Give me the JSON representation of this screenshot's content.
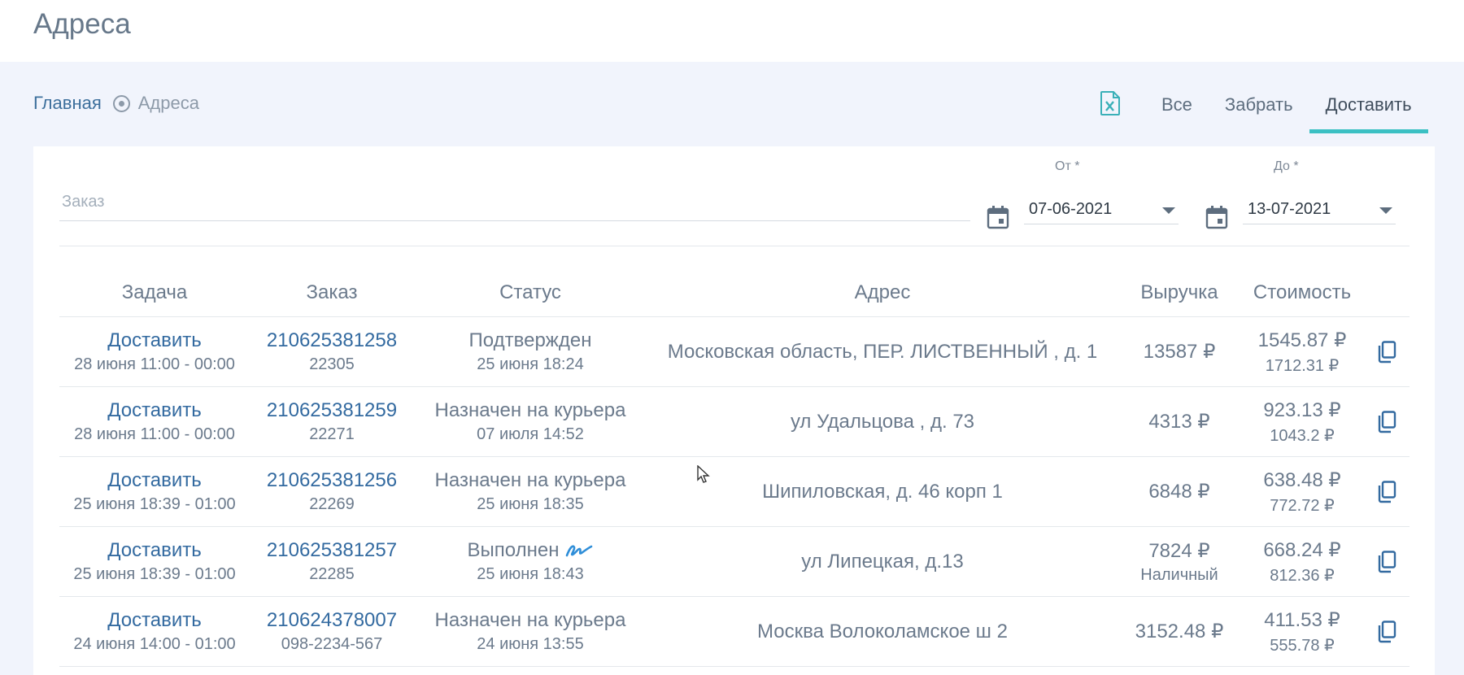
{
  "header": {
    "title": "Адреса"
  },
  "breadcrumb": {
    "home": "Главная",
    "current": "Адреса"
  },
  "toolbar": {
    "export_icon": "excel-file-icon"
  },
  "tabs": [
    {
      "label": "Все",
      "active": false
    },
    {
      "label": "Забрать",
      "active": false
    },
    {
      "label": "Доставить",
      "active": true
    }
  ],
  "filters": {
    "order_placeholder": "Заказ",
    "from": {
      "label": "От *",
      "value": "07-06-2021"
    },
    "to": {
      "label": "До *",
      "value": "13-07-2021"
    }
  },
  "table": {
    "headers": [
      "Задача",
      "Заказ",
      "Статус",
      "Адрес",
      "Выручка",
      "Стоимость"
    ],
    "rows": [
      {
        "task": "Доставить",
        "task_time": "28 июня 11:00 - 00:00",
        "order": "210625381258",
        "order_sub": "22305",
        "status": "Подтвержден",
        "status_time": "25 июня 18:24",
        "address": "Московская область, ПЕР. ЛИСТВЕННЫЙ , д. 1",
        "revenue": "13587 ₽",
        "revenue_sub": "",
        "cost": "1545.87 ₽",
        "cost_sub": "1712.31 ₽"
      },
      {
        "task": "Доставить",
        "task_time": "28 июня 11:00 - 00:00",
        "order": "210625381259",
        "order_sub": "22271",
        "status": "Назначен на курьера",
        "status_time": "07 июля 14:52",
        "address": "ул Удальцова , д. 73",
        "revenue": "4313 ₽",
        "revenue_sub": "",
        "cost": "923.13 ₽",
        "cost_sub": "1043.2 ₽"
      },
      {
        "task": "Доставить",
        "task_time": "25 июня 18:39 - 01:00",
        "order": "210625381256",
        "order_sub": "22269",
        "status": "Назначен на курьера",
        "status_time": "25 июня 18:35",
        "address": "Шипиловская, д. 46 корп 1",
        "revenue": "6848 ₽",
        "revenue_sub": "",
        "cost": "638.48 ₽",
        "cost_sub": "772.72 ₽"
      },
      {
        "task": "Доставить",
        "task_time": "25 июня 18:39 - 01:00",
        "order": "210625381257",
        "order_sub": "22285",
        "status": "Выполнен",
        "status_time": "25 июня 18:43",
        "address": "ул Липецкая, д.13",
        "revenue": "7824 ₽",
        "revenue_sub": "Наличный",
        "cost": "668.24 ₽",
        "cost_sub": "812.36 ₽"
      },
      {
        "task": "Доставить",
        "task_time": "24 июня 14:00 - 01:00",
        "order": "210624378007",
        "order_sub": "098-2234-567",
        "status": "Назначен на курьера",
        "status_time": "24 июня 13:55",
        "address": "Москва Волоколамское ш 2",
        "revenue": "3152.48 ₽",
        "revenue_sub": "",
        "cost": "411.53 ₽",
        "cost_sub": "555.78 ₽"
      }
    ]
  },
  "colors": {
    "accent": "#3bc0c3",
    "link": "#336aa0",
    "page_bg": "#f1f4fc"
  }
}
